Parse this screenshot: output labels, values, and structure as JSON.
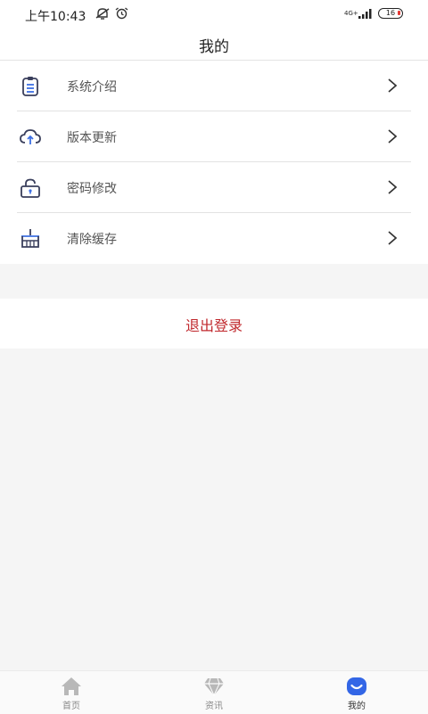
{
  "status_bar": {
    "time": "上午10:43",
    "network": "4G+",
    "battery": "16"
  },
  "header": {
    "title": "我的"
  },
  "menu": [
    {
      "label": "系统介绍",
      "icon": "clipboard-icon"
    },
    {
      "label": "版本更新",
      "icon": "cloud-upload-icon"
    },
    {
      "label": "密码修改",
      "icon": "lock-icon"
    },
    {
      "label": "清除缓存",
      "icon": "broom-icon"
    }
  ],
  "logout": {
    "label": "退出登录",
    "color": "#c0282d"
  },
  "tabbar": {
    "items": [
      {
        "label": "首页",
        "icon": "home-icon",
        "active": false
      },
      {
        "label": "资讯",
        "icon": "diamond-icon",
        "active": false
      },
      {
        "label": "我的",
        "icon": "profile-smile-icon",
        "active": true
      }
    ],
    "active_color": "#3366e6",
    "inactive_color": "#b8b8b8"
  }
}
